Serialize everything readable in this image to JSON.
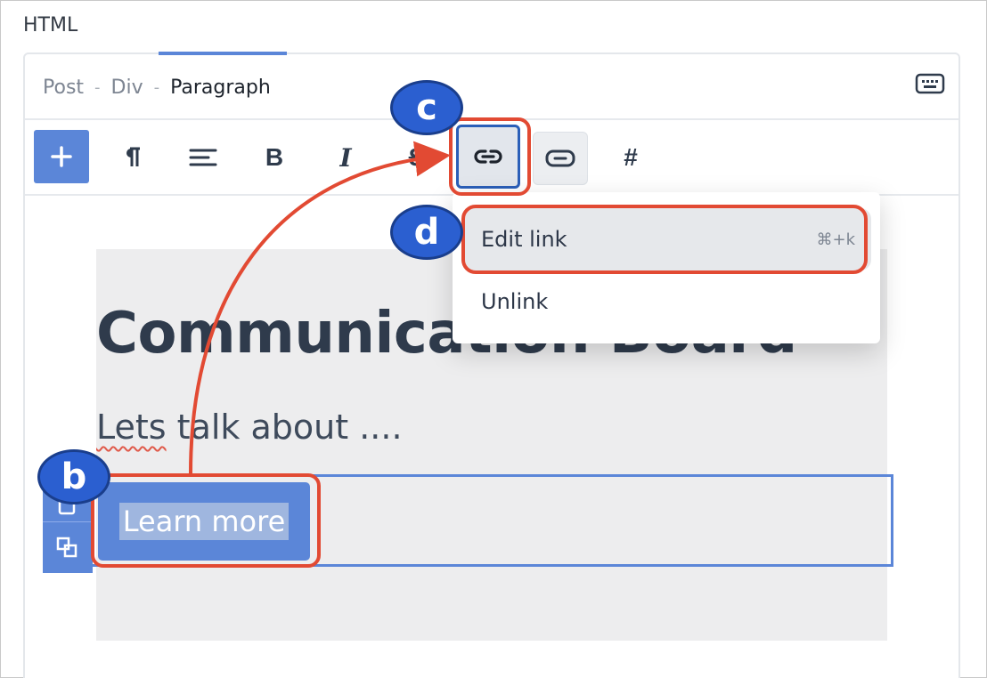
{
  "section_label": "HTML",
  "breadcrumb": {
    "items": [
      "Post",
      "Div",
      "Paragraph"
    ],
    "separator": "-"
  },
  "toolbar": {
    "add": "+",
    "paragraph_icon": "pilcrow-icon",
    "align_icon": "align-left-icon",
    "bold": "B",
    "italic": "I",
    "strike": "S",
    "link_icon": "link-icon",
    "button_icon": "button-icon",
    "anchor": "#"
  },
  "content": {
    "heading": "Communication Board",
    "subtitle_pre": "Lets",
    "subtitle_post": " talk about ....",
    "button_label": "Learn more"
  },
  "dropdown": {
    "edit_link": "Edit link",
    "edit_shortcut": "⌘+k",
    "unlink": "Unlink"
  },
  "annotations": {
    "b": "b",
    "c": "c",
    "d": "d"
  },
  "colors": {
    "accent": "#5b86d8",
    "highlight": "#e24a33",
    "badge": "#2b5fd0"
  }
}
